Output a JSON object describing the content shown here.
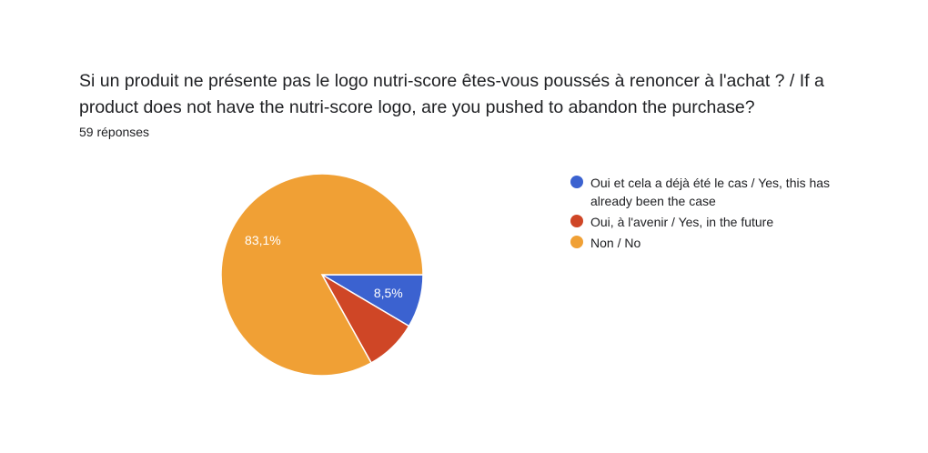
{
  "title": "Si un produit ne présente pas le logo nutri-score êtes-vous poussés à renoncer à l'achat ? / If a product does not have the nutri-score logo, are you pushed to abandon the purchase?",
  "responses_label": "59 réponses",
  "chart_data": {
    "type": "pie",
    "title": "Si un produit ne présente pas le logo nutri-score êtes-vous poussés à renoncer à l'achat ? / If a product does not have the nutri-score logo, are you pushed to abandon the purchase?",
    "legend_position": "right",
    "start": "3 o'clock, clockwise",
    "slices": [
      {
        "label": "Oui et cela a déjà été le cas / Yes, this has already been the case",
        "value": 8.5,
        "value_label": "8,5%",
        "color": "#3b62d0"
      },
      {
        "label": "Oui, à l'avenir / Yes, in the future",
        "value": 8.4,
        "value_label": "",
        "color": "#cf4626"
      },
      {
        "label": "Non / No",
        "value": 83.1,
        "value_label": "83,1%",
        "color": "#f0a035"
      }
    ]
  }
}
